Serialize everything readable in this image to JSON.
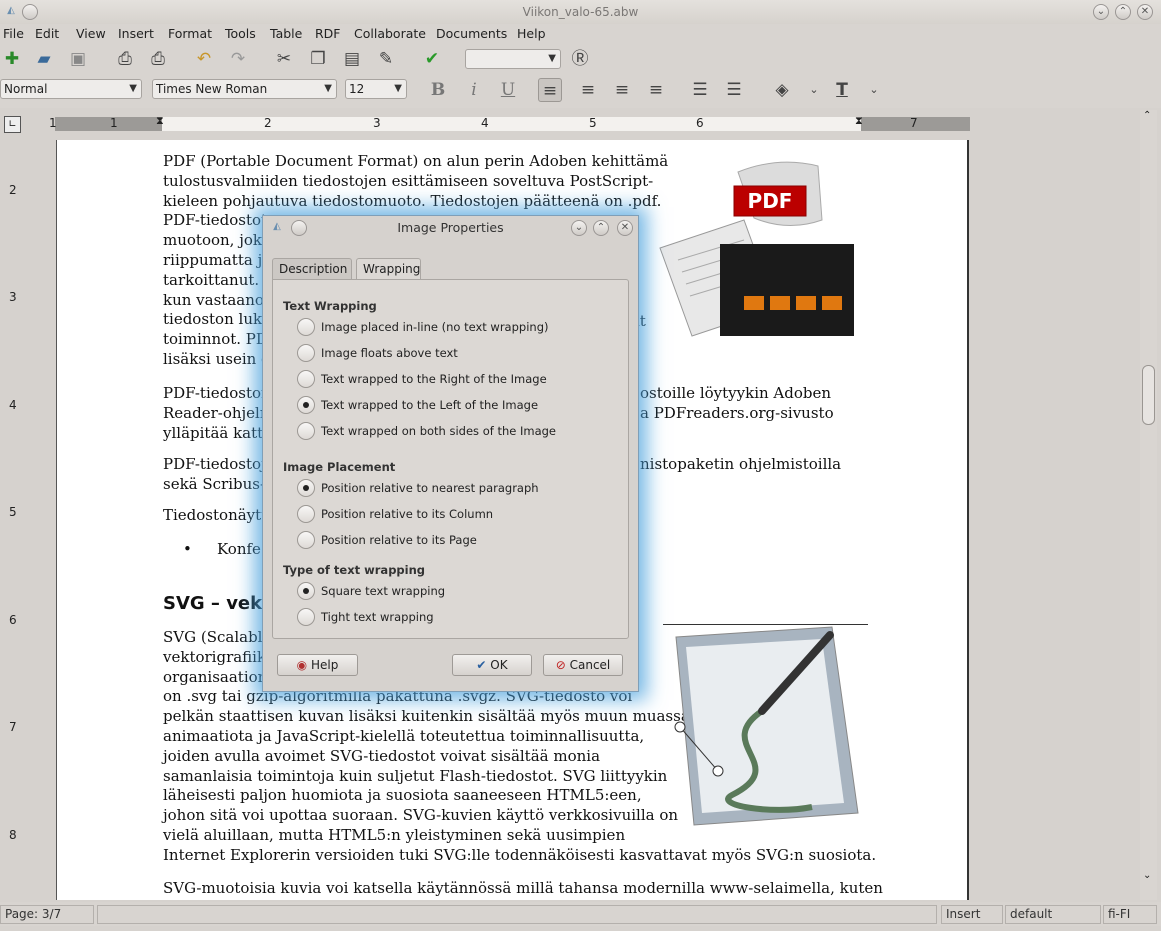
{
  "window": {
    "title": "Viikon_valo-65.abw"
  },
  "menu": [
    "File",
    "Edit",
    "View",
    "Insert",
    "Format",
    "Tools",
    "Table",
    "RDF",
    "Collaborate",
    "Documents",
    "Help"
  ],
  "format_bar": {
    "style": "Normal",
    "font": "Times New Roman",
    "size": "12"
  },
  "ruler": {
    "h_numbers": [
      "1",
      "1",
      "2",
      "3",
      "4",
      "5",
      "6",
      "7"
    ],
    "v_numbers": [
      "2",
      "3",
      "4",
      "5",
      "6",
      "7",
      "8"
    ]
  },
  "document": {
    "p1a": "PDF (Portable Document Format) on alun perin Adoben kehittämä",
    "p1b": "tulostusvalmiiden tiedostojen esittämiseen soveltuva PostScript-",
    "p1c": "kieleen pohjautuva tiedostomuoto. Tiedostojen päätteenä on .pdf.",
    "p1d": "PDF-tiedostot",
    "p1e": "muotoon, joka",
    "p1f": "riippumatta ju",
    "p1g": "tarkoittanut. H",
    "p1h": "kun vastaanot",
    "p1i": "tiedoston luke",
    "p1i2": "it",
    "p1j": "toiminnot. PD",
    "p1k": "lisäksi usein e",
    "p2a": "PDF-tiedoston",
    "p2a2": "ostoille löytyykin Adoben",
    "p2b": "Reader-ohjelm",
    "p2b2": "a PDFreaders.org-sivusto",
    "p2c": "ylläpitää katta",
    "p3a": "PDF-tiedostoj",
    "p3a2": "nistopaketin ohjelmistoilla",
    "p3b": "sekä Scribus-",
    "p4": "Tiedostonäytt",
    "bullet": "Konfe",
    "heading": "SVG – vek",
    "s1": "SVG (Scalabl",
    "s2": "vektorigrafiik",
    "s3": "organisaation",
    "s4": "on .svg tai gzip-algoritmilla pakattuna .svgz. SVG-tiedosto voi",
    "s5": "pelkän staattisen kuvan lisäksi kuitenkin sisältää myös muun muassa",
    "s6": "animaatiota ja JavaScript-kielellä toteutettua toiminnallisuutta,",
    "s7": "joiden avulla avoimet SVG-tiedostot voivat sisältää monia",
    "s8": "samanlaisia toimintoja kuin suljetut Flash-tiedostot. SVG liittyykin",
    "s9": "läheisesti paljon huomiota ja suosiota saaneeseen HTML5:een,",
    "s10": "johon sitä voi upottaa suoraan. SVG-kuvien käyttö verkkosivuilla on",
    "s11": "vielä aluillaan, mutta HTML5:n yleistyminen sekä uusimpien",
    "s12": "Internet Explorerin versioiden tuki SVG:lle todennäköisesti kasvattavat myös SVG:n suosiota.",
    "s13": "SVG-muotoisia kuvia voi katsella käytännössä millä tahansa modernilla www-selaimella, kuten"
  },
  "pdf_label": "PDF",
  "dialog": {
    "title": "Image Properties",
    "tabs": [
      "Description",
      "Wrapping"
    ],
    "text_wrapping": {
      "heading": "Text Wrapping",
      "options": [
        "Image placed in-line (no text wrapping)",
        "Image floats above text",
        "Text wrapped to the Right of the Image",
        "Text wrapped to the Left of the Image",
        "Text wrapped on both sides of the Image"
      ],
      "selected": 3
    },
    "placement": {
      "heading": "Image Placement",
      "options": [
        "Position relative to nearest paragraph",
        "Position relative to its Column",
        "Position relative to its Page"
      ],
      "selected": 0
    },
    "type": {
      "heading": "Type of text wrapping",
      "options": [
        "Square text wrapping",
        "Tight text wrapping"
      ],
      "selected": 0
    },
    "help": "Help",
    "ok": "OK",
    "cancel": "Cancel"
  },
  "status": {
    "page": "Page: 3/7",
    "mode": "Insert",
    "style": "default",
    "lang": "fi-FI"
  }
}
